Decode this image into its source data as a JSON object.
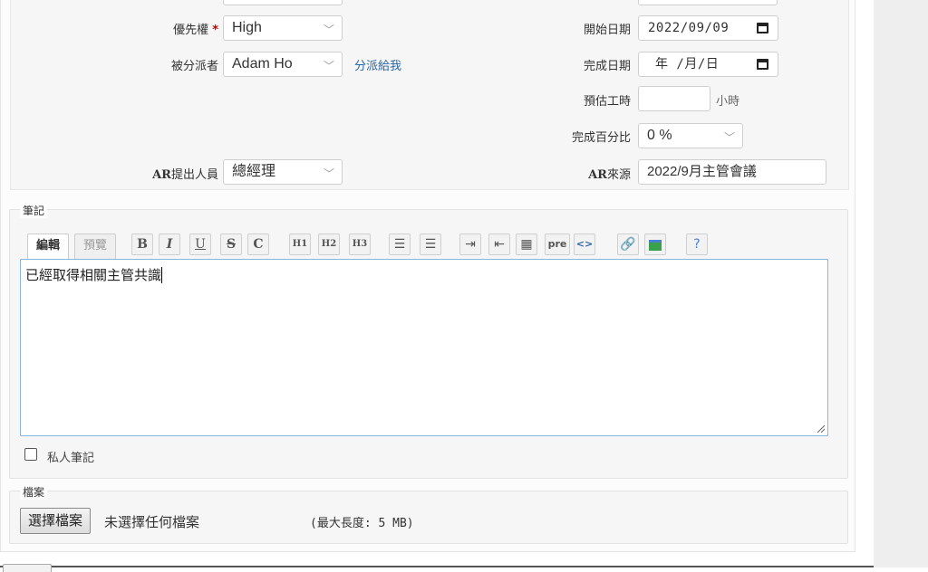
{
  "form": {
    "priority": {
      "label": "優先權",
      "required_mark": "*",
      "value": "High"
    },
    "assignee": {
      "label": "被分派者",
      "value": "Adam Ho",
      "assign_to_me": "分派給我"
    },
    "start_date": {
      "label": "開始日期",
      "value": "2022/09/09"
    },
    "due_date": {
      "label": "完成日期",
      "value": "年 /月/日"
    },
    "estimated_time": {
      "label": "預估工時",
      "value": "",
      "unit": "小時"
    },
    "done_ratio": {
      "label": "完成百分比",
      "value": "0 %"
    },
    "ar_submitter": {
      "label_prefix": "AR",
      "label_suffix": "提出人員",
      "value": "總經理"
    },
    "ar_source": {
      "label_prefix": "AR",
      "label_suffix": "來源",
      "value": "2022/9月主管會議"
    }
  },
  "notes": {
    "legend": "筆記",
    "tabs": {
      "edit": "編輯",
      "preview": "預覽"
    },
    "toolbar": {
      "bold": "B",
      "italic": "I",
      "underline": "U",
      "strike": "S",
      "code": "C",
      "h1": "H1",
      "h2": "H2",
      "h3": "H3",
      "pre": "pre",
      "inline_code": "<>"
    },
    "content": "已經取得相關主管共識",
    "private_label": "私人筆記"
  },
  "files": {
    "legend": "檔案",
    "choose_button": "選擇檔案",
    "no_file": "未選擇任何檔案",
    "max_size": "(最大長度: 5 MB)"
  },
  "colors": {
    "accent": "#2a64a8",
    "required": "#bb0000",
    "editor_border": "#8ab6dc"
  }
}
